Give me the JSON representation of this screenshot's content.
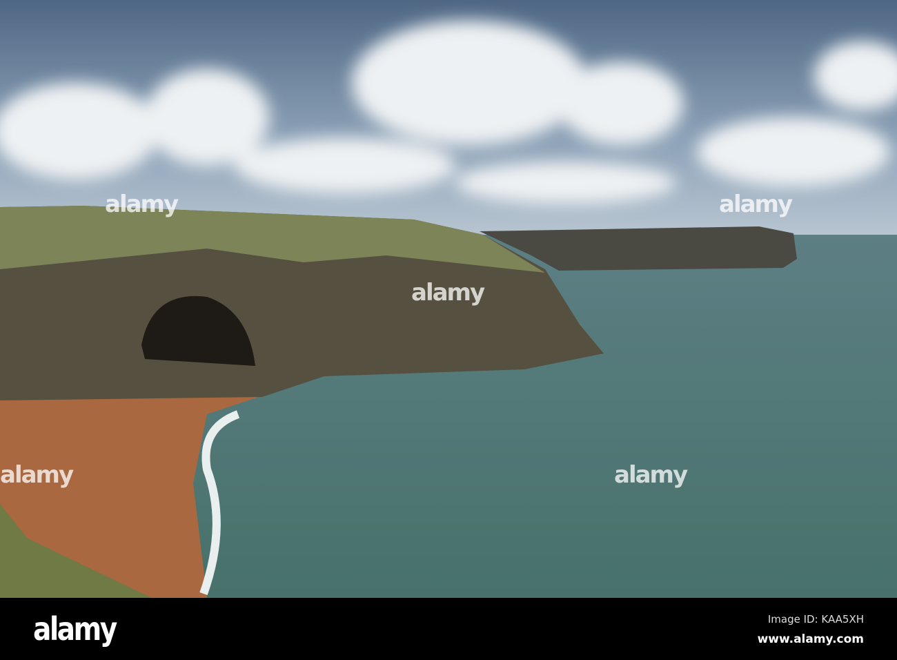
{
  "footer": {
    "logo": "alamy",
    "image_id": "Image ID: KAA5XH",
    "url": "www.alamy.com"
  },
  "watermark": "alamy",
  "colors": {
    "sky": "#5d7793",
    "sea": "#4f7672",
    "sand": "#a9683f",
    "cliff": "#4f4a3f",
    "grass": "#7c8458"
  }
}
